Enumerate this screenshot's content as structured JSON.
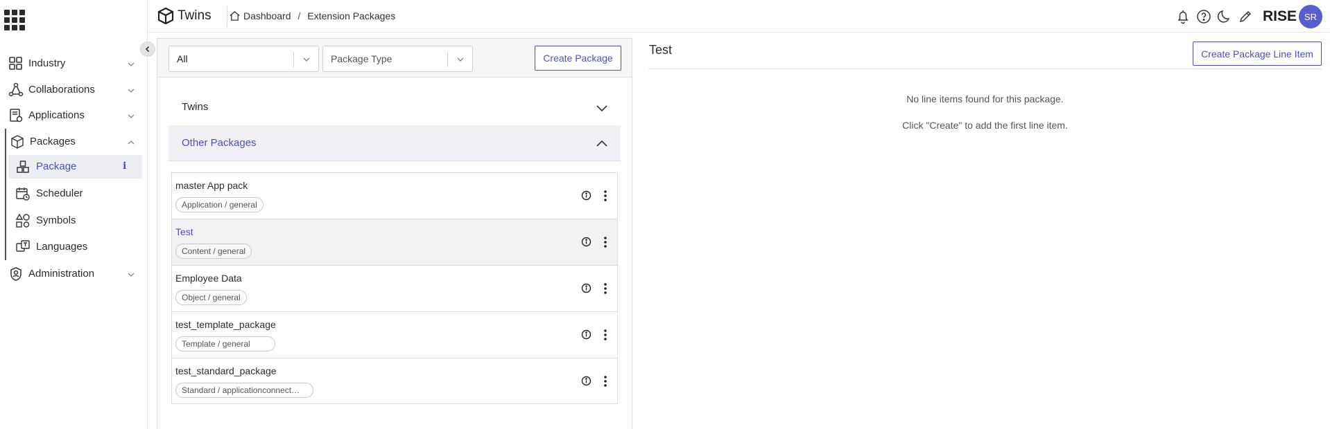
{
  "header": {
    "brand": "Twins",
    "breadcrumb": [
      "Dashboard",
      "Extension Packages"
    ],
    "user_org": "RISE",
    "user_initials": "SR",
    "accent_color": "#4b4fc2"
  },
  "sidebar": {
    "items": [
      {
        "label": "Industry",
        "icon": "industry-icon",
        "expanded": false
      },
      {
        "label": "Collaborations",
        "icon": "collaborations-icon",
        "expanded": false
      },
      {
        "label": "Applications",
        "icon": "applications-icon",
        "expanded": false
      },
      {
        "label": "Packages",
        "icon": "packages-icon",
        "expanded": true
      },
      {
        "label": "Administration",
        "icon": "administration-icon",
        "expanded": false
      }
    ],
    "sub_items": [
      {
        "label": "Package",
        "icon": "package-icon",
        "active": true,
        "info": "i"
      },
      {
        "label": "Scheduler",
        "icon": "scheduler-icon"
      },
      {
        "label": "Symbols",
        "icon": "symbols-icon"
      },
      {
        "label": "Languages",
        "icon": "languages-icon"
      }
    ]
  },
  "filters": {
    "scope_value": "All",
    "type_placeholder": "Package Type",
    "create_label": "Create Package"
  },
  "accordion": {
    "twins_label": "Twins",
    "other_label": "Other Packages"
  },
  "packages": [
    {
      "name": "master App pack",
      "tag": "Application / general"
    },
    {
      "name": "Test",
      "tag": "Content / general",
      "selected": true
    },
    {
      "name": "Employee Data",
      "tag": "Object / general"
    },
    {
      "name": "test_template_package",
      "tag": "Template / general"
    },
    {
      "name": "test_standard_package",
      "tag": "Standard / applicationconnect…"
    }
  ],
  "detail": {
    "title": "Test",
    "create_line_item_label": "Create Package Line Item",
    "empty_line1": "No line items found for this package.",
    "empty_line2": "Click \"Create\" to add the first line item."
  }
}
